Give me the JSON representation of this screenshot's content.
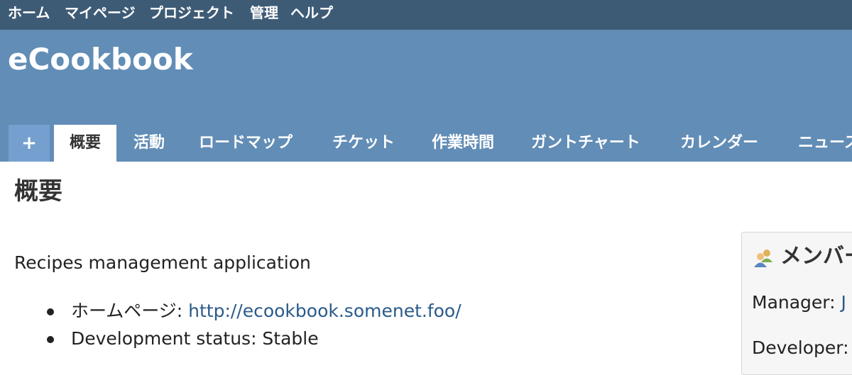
{
  "top_menu": {
    "items": [
      "ホーム",
      "マイページ",
      "プロジェクト",
      "管理",
      "ヘルプ"
    ]
  },
  "header": {
    "title": "eCookbook"
  },
  "tabs": {
    "new_label": "+",
    "items": [
      "概要",
      "活動",
      "ロードマップ",
      "チケット",
      "作業時間",
      "ガントチャート",
      "カレンダー",
      "ニュース"
    ],
    "active": "概要"
  },
  "main": {
    "heading": "概要",
    "description": "Recipes management application",
    "info": [
      {
        "label": "ホームページ: ",
        "link": "http://ecookbook.somenet.foo/"
      },
      {
        "label": "Development status: Stable"
      }
    ]
  },
  "members": {
    "title": "メンバー",
    "roles": [
      {
        "label": "Manager: ",
        "user": "J"
      },
      {
        "label": "Developer: "
      }
    ]
  },
  "colors": {
    "top_menu_bg": "#3e5b76",
    "header_bg": "#628db6",
    "new_tab_bg": "#759fcf",
    "link": "#2a5a8a"
  }
}
